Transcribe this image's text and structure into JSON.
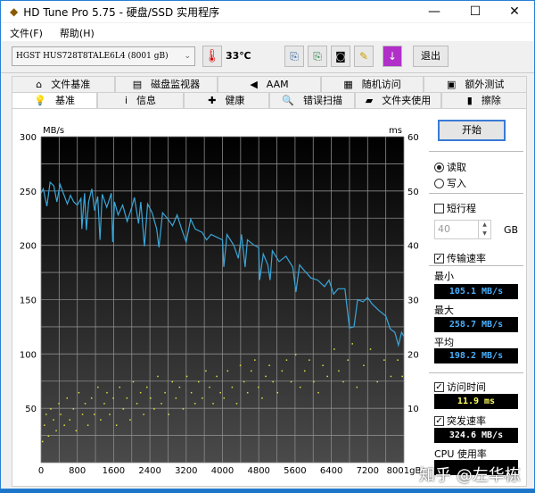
{
  "window": {
    "title": "HD Tune Pro 5.75 - 硬盘/SSD 实用程序",
    "minimize": "—",
    "maximize": "☐",
    "close": "✕"
  },
  "menu": [
    "文件(F)",
    "帮助(H)"
  ],
  "toolbar": {
    "drive": "HGST HUS728T8TALE6L4 (8001 gB)",
    "temperature": "33℃",
    "exit": "退出",
    "icons": [
      "copy-info-icon",
      "copy-all-icon",
      "screenshot-icon",
      "options-icon",
      "save-icon"
    ]
  },
  "tabs_top": [
    {
      "label": "文件基准",
      "icon": "file-benchmark-icon",
      "glyph": "⌂"
    },
    {
      "label": "磁盘监视器",
      "icon": "disk-monitor-icon",
      "glyph": "▤"
    },
    {
      "label": "AAM",
      "icon": "speaker-icon",
      "glyph": "◀"
    },
    {
      "label": "随机访问",
      "icon": "random-access-icon",
      "glyph": "▦"
    },
    {
      "label": "额外测试",
      "icon": "extra-tests-icon",
      "glyph": "▣"
    }
  ],
  "tabs_bottom": [
    {
      "label": "基准",
      "icon": "benchmark-icon",
      "glyph": "💡",
      "active": true
    },
    {
      "label": "信息",
      "icon": "info-icon",
      "glyph": "i"
    },
    {
      "label": "健康",
      "icon": "health-icon",
      "glyph": "✚"
    },
    {
      "label": "错误扫描",
      "icon": "error-scan-icon",
      "glyph": "🔍"
    },
    {
      "label": "文件夹使用",
      "icon": "folder-icon",
      "glyph": "▰"
    },
    {
      "label": "擦除",
      "icon": "erase-icon",
      "glyph": "▮"
    }
  ],
  "panel": {
    "start": "开始",
    "read": "读取",
    "write": "写入",
    "short_stroke": "短行程",
    "short_stroke_value": "40",
    "gb": "GB",
    "transfer_rate": "传输速率",
    "min_label": "最小",
    "min": "105.1 MB/s",
    "max_label": "最大",
    "max": "258.7 MB/s",
    "avg_label": "平均",
    "avg": "198.2 MB/s",
    "access_time_label": "访问时间",
    "access_time": "11.9 ms",
    "burst_label": "突发速率",
    "burst": "324.6 MB/s",
    "cpu_label": "CPU 使用率"
  },
  "watermark": "知乎 @左华栋",
  "colors": {
    "transfer": "#3aa6d8",
    "access": "#e0e040",
    "display_blue": "#4ab0ff",
    "display_yellow": "#ffff60"
  },
  "chart_data": {
    "type": "line",
    "left_unit": "MB/s",
    "right_unit": "ms",
    "x_unit": "gB",
    "ylim": [
      0,
      300
    ],
    "y2lim": [
      0,
      60
    ],
    "xlim": [
      0,
      8001
    ],
    "y_ticks": [
      "300",
      "250",
      "200",
      "150",
      "100",
      "50"
    ],
    "y2_ticks": [
      "60",
      "50",
      "40",
      "30",
      "20",
      "10"
    ],
    "x_ticks": [
      "0",
      "800",
      "1600",
      "2400",
      "3200",
      "4000",
      "4800",
      "5600",
      "6400",
      "7200",
      "8001gB"
    ],
    "transfer_series": [
      [
        0,
        248
      ],
      [
        50,
        252
      ],
      [
        130,
        236
      ],
      [
        200,
        258
      ],
      [
        280,
        255
      ],
      [
        350,
        240
      ],
      [
        420,
        256
      ],
      [
        500,
        247
      ],
      [
        580,
        238
      ],
      [
        650,
        246
      ],
      [
        720,
        240
      ],
      [
        800,
        237
      ],
      [
        880,
        243
      ],
      [
        900,
        215
      ],
      [
        960,
        248
      ],
      [
        1000,
        214
      ],
      [
        1050,
        240
      ],
      [
        1120,
        252
      ],
      [
        1180,
        232
      ],
      [
        1250,
        245
      ],
      [
        1300,
        205
      ],
      [
        1350,
        247
      ],
      [
        1450,
        235
      ],
      [
        1550,
        248
      ],
      [
        1580,
        203
      ],
      [
        1620,
        240
      ],
      [
        1700,
        228
      ],
      [
        1800,
        237
      ],
      [
        1900,
        222
      ],
      [
        2000,
        235
      ],
      [
        2060,
        244
      ],
      [
        2150,
        220
      ],
      [
        2200,
        240
      ],
      [
        2280,
        199
      ],
      [
        2350,
        238
      ],
      [
        2450,
        230
      ],
      [
        2550,
        215
      ],
      [
        2600,
        198
      ],
      [
        2680,
        230
      ],
      [
        2800,
        224
      ],
      [
        2900,
        218
      ],
      [
        3000,
        228
      ],
      [
        3100,
        215
      ],
      [
        3200,
        203
      ],
      [
        3300,
        224
      ],
      [
        3400,
        215
      ],
      [
        3550,
        212
      ],
      [
        3650,
        205
      ],
      [
        3750,
        210
      ],
      [
        3900,
        207
      ],
      [
        4000,
        205
      ],
      [
        4030,
        180
      ],
      [
        4100,
        210
      ],
      [
        4250,
        200
      ],
      [
        4350,
        188
      ],
      [
        4420,
        210
      ],
      [
        4500,
        180
      ],
      [
        4550,
        205
      ],
      [
        4700,
        200
      ],
      [
        4800,
        198
      ],
      [
        4820,
        168
      ],
      [
        4900,
        192
      ],
      [
        5000,
        182
      ],
      [
        5050,
        168
      ],
      [
        5100,
        195
      ],
      [
        5250,
        185
      ],
      [
        5400,
        190
      ],
      [
        5550,
        180
      ],
      [
        5620,
        157
      ],
      [
        5700,
        182
      ],
      [
        5800,
        177
      ],
      [
        5950,
        170
      ],
      [
        6100,
        168
      ],
      [
        6250,
        162
      ],
      [
        6350,
        168
      ],
      [
        6450,
        155
      ],
      [
        6550,
        160
      ],
      [
        6700,
        160
      ],
      [
        6800,
        124
      ],
      [
        6900,
        125
      ],
      [
        6980,
        150
      ],
      [
        7100,
        148
      ],
      [
        7200,
        152
      ],
      [
        7300,
        146
      ],
      [
        7450,
        140
      ],
      [
        7600,
        135
      ],
      [
        7700,
        123
      ],
      [
        7800,
        120
      ],
      [
        7880,
        108
      ],
      [
        7950,
        120
      ],
      [
        8001,
        116
      ]
    ],
    "access_points_ms": [
      [
        20,
        4
      ],
      [
        60,
        7
      ],
      [
        100,
        9
      ],
      [
        150,
        5
      ],
      [
        200,
        10
      ],
      [
        260,
        8
      ],
      [
        320,
        6
      ],
      [
        380,
        11
      ],
      [
        420,
        9
      ],
      [
        500,
        7
      ],
      [
        560,
        12
      ],
      [
        620,
        8
      ],
      [
        700,
        10
      ],
      [
        760,
        6
      ],
      [
        820,
        13
      ],
      [
        900,
        9
      ],
      [
        960,
        11
      ],
      [
        1020,
        7
      ],
      [
        1100,
        12
      ],
      [
        1160,
        9
      ],
      [
        1240,
        14
      ],
      [
        1300,
        8
      ],
      [
        1380,
        11
      ],
      [
        1440,
        13
      ],
      [
        1500,
        9
      ],
      [
        1580,
        12
      ],
      [
        1650,
        7
      ],
      [
        1720,
        14
      ],
      [
        1800,
        10
      ],
      [
        1880,
        12
      ],
      [
        1950,
        8
      ],
      [
        2020,
        15
      ],
      [
        2100,
        11
      ],
      [
        2180,
        13
      ],
      [
        2250,
        9
      ],
      [
        2320,
        14
      ],
      [
        2400,
        12
      ],
      [
        2480,
        10
      ],
      [
        2560,
        16
      ],
      [
        2640,
        11
      ],
      [
        2720,
        13
      ],
      [
        2800,
        9
      ],
      [
        2880,
        15
      ],
      [
        2960,
        12
      ],
      [
        3040,
        14
      ],
      [
        3120,
        10
      ],
      [
        3200,
        16
      ],
      [
        3300,
        13
      ],
      [
        3380,
        11
      ],
      [
        3460,
        15
      ],
      [
        3540,
        12
      ],
      [
        3620,
        17
      ],
      [
        3700,
        14
      ],
      [
        3780,
        11
      ],
      [
        3860,
        16
      ],
      [
        3940,
        13
      ],
      [
        4020,
        12
      ],
      [
        4100,
        17
      ],
      [
        4200,
        14
      ],
      [
        4300,
        11
      ],
      [
        4380,
        18
      ],
      [
        4460,
        15
      ],
      [
        4540,
        13
      ],
      [
        4620,
        17
      ],
      [
        4700,
        19
      ],
      [
        4780,
        14
      ],
      [
        4860,
        12
      ],
      [
        4940,
        16
      ],
      [
        5020,
        18
      ],
      [
        5100,
        15
      ],
      [
        5200,
        13
      ],
      [
        5300,
        17
      ],
      [
        5400,
        19
      ],
      [
        5500,
        15
      ],
      [
        5600,
        20
      ],
      [
        5700,
        14
      ],
      [
        5800,
        17
      ],
      [
        5900,
        19
      ],
      [
        6000,
        15
      ],
      [
        6100,
        13
      ],
      [
        6200,
        18
      ],
      [
        6300,
        16
      ],
      [
        6450,
        21
      ],
      [
        6550,
        17
      ],
      [
        6650,
        15
      ],
      [
        6750,
        19
      ],
      [
        6850,
        22
      ],
      [
        6950,
        14
      ],
      [
        7100,
        18
      ],
      [
        7250,
        21
      ],
      [
        7400,
        15
      ],
      [
        7550,
        19
      ],
      [
        7700,
        16
      ],
      [
        7850,
        19
      ],
      [
        7950,
        16
      ]
    ]
  }
}
